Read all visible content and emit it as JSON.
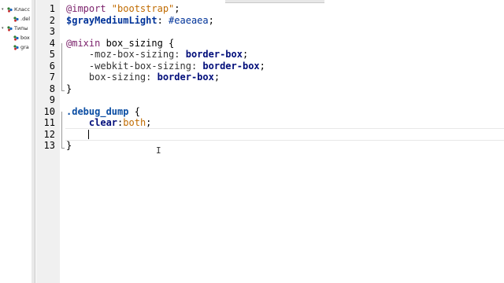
{
  "navigator": {
    "items": [
      {
        "toggle": "▾",
        "icon": "class-icon",
        "label": "Класс"
      },
      {
        "toggle": "",
        "icon": "item-icon",
        "label": ".del"
      },
      {
        "toggle": "▾",
        "icon": "types-icon",
        "label": "Типы"
      },
      {
        "toggle": "",
        "icon": "item-icon",
        "label": "box"
      },
      {
        "toggle": "",
        "icon": "item-icon",
        "label": "gra"
      }
    ]
  },
  "editor": {
    "line_numbers": [
      "1",
      "2",
      "3",
      "4",
      "5",
      "6",
      "7",
      "8",
      "9",
      "10",
      "11",
      "12",
      "13"
    ],
    "current_line": 12,
    "lines": [
      [
        {
          "c": "kw",
          "t": "@import "
        },
        {
          "c": "str",
          "t": "\"bootstrap\""
        },
        {
          "c": "",
          "t": ";"
        }
      ],
      [
        {
          "c": "var",
          "t": "$grayMediumLight"
        },
        {
          "c": "",
          "t": ": "
        },
        {
          "c": "val",
          "t": "#eaeaea"
        },
        {
          "c": "",
          "t": ";"
        }
      ],
      [],
      [
        {
          "c": "kw",
          "t": "@mixin "
        },
        {
          "c": "",
          "t": "box_sizing {"
        }
      ],
      [
        {
          "c": "prop",
          "t": "    -moz-box-sizing: "
        },
        {
          "c": "bold",
          "t": "border-box"
        },
        {
          "c": "",
          "t": ";"
        }
      ],
      [
        {
          "c": "prop",
          "t": "    -webkit-box-sizing: "
        },
        {
          "c": "bold",
          "t": "border-box"
        },
        {
          "c": "",
          "t": ";"
        }
      ],
      [
        {
          "c": "prop",
          "t": "    box-sizing: "
        },
        {
          "c": "bold",
          "t": "border-box"
        },
        {
          "c": "",
          "t": ";"
        }
      ],
      [
        {
          "c": "",
          "t": "}"
        }
      ],
      [],
      [
        {
          "c": "sel",
          "t": ".debug_dump"
        },
        {
          "c": "",
          "t": " {"
        }
      ],
      [
        {
          "c": "prop",
          "t": "    "
        },
        {
          "c": "bold",
          "t": "clear"
        },
        {
          "c": "",
          "t": ":"
        },
        {
          "c": "str",
          "t": "both"
        },
        {
          "c": "",
          "t": ";"
        }
      ],
      [
        {
          "c": "",
          "t": "    "
        }
      ],
      [
        {
          "c": "",
          "t": "}"
        }
      ]
    ]
  }
}
